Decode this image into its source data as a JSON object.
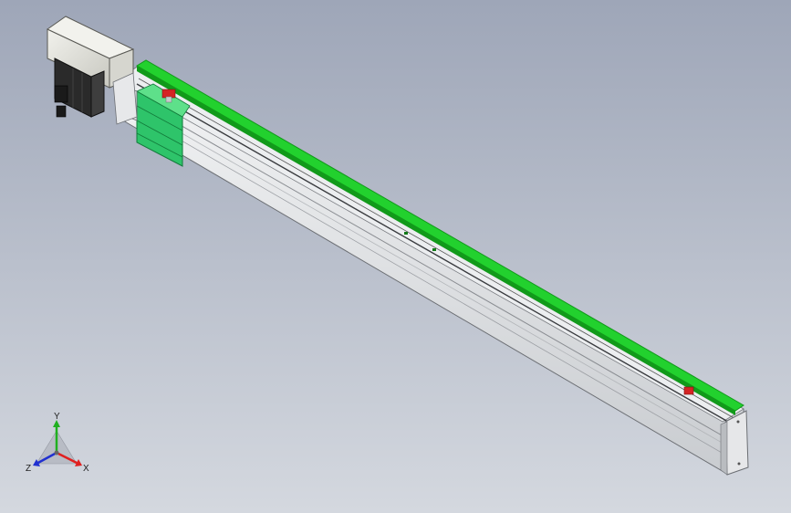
{
  "viewport": {
    "background_top": "#9ea6b8",
    "background_bottom": "#d4d8df"
  },
  "model": {
    "rail_color": "#e8e9ea",
    "rail_shadow": "#a9acb0",
    "guide_color": "#22d12e",
    "guide_dark": "#119a1a",
    "carriage_color": "#2ec46a",
    "motor_body_color": "#2a2a2a",
    "motor_housing_color": "#e3e3dc",
    "limit_sensor_color": "#d42424"
  },
  "triad": {
    "x_label": "X",
    "y_label": "Y",
    "z_label": "Z",
    "x_color": "#e02020",
    "y_color": "#20b020",
    "z_color": "#2030d0"
  }
}
